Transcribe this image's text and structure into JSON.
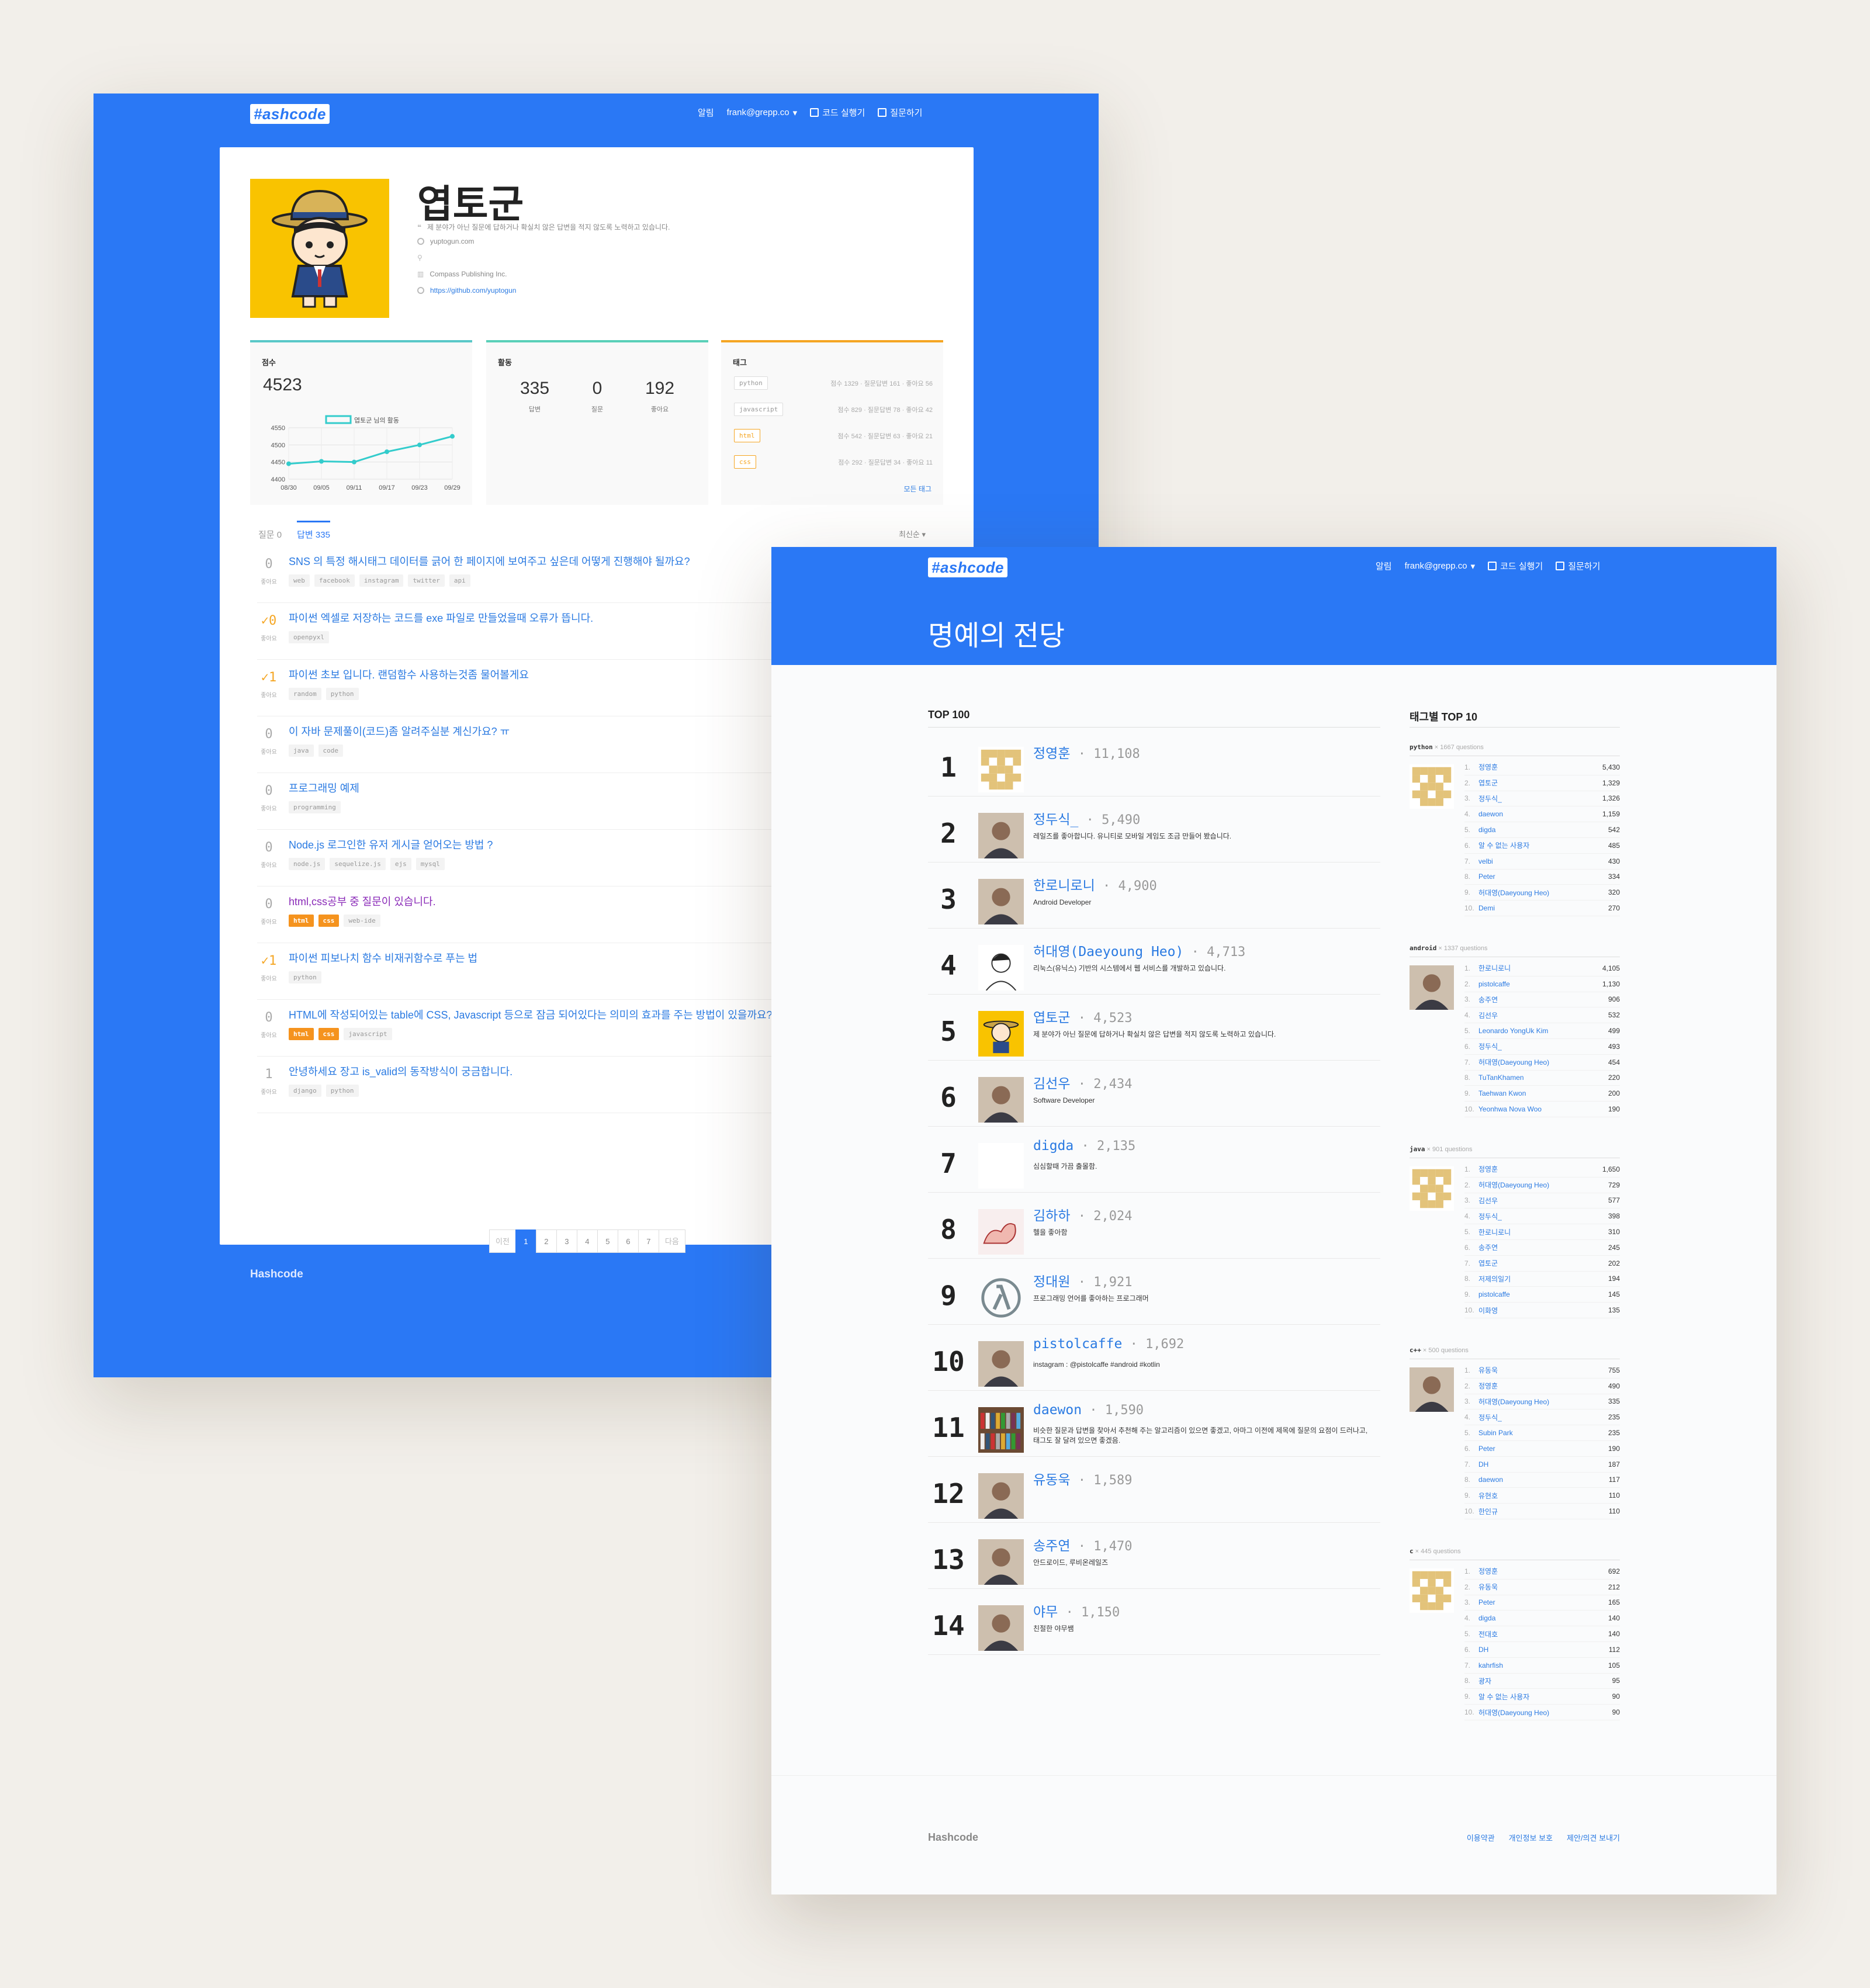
{
  "profile_page": {
    "nav": {
      "logo": "#ashcode",
      "alerts": "알림",
      "user": "frank@grepp.co",
      "run_code": "코드 실행기",
      "ask": "질문하기"
    },
    "user": {
      "name": "엽토군",
      "bio": "제 분야가 아닌 질문에 답하거나 확실치 않은 답변을 적지 않도록 노력하고 있습니다.",
      "website": "yuptogun.com",
      "location": "",
      "company": "Compass Publishing Inc.",
      "github": "https://github.com/yuptogun"
    },
    "score_box": {
      "title": "점수",
      "score": "4523",
      "legend": "엽토군 님의 활동",
      "chart_data": {
        "type": "line",
        "x": [
          "08/30",
          "09/05",
          "09/11",
          "09/17",
          "09/23",
          "09/29"
        ],
        "y_ticks": [
          "4550",
          "4500",
          "4450",
          "4400"
        ],
        "ylim": [
          4400,
          4550
        ],
        "series": [
          {
            "values": [
              4445,
              4452,
              4450,
              4480,
              4500,
              4525
            ]
          }
        ]
      }
    },
    "activity_box": {
      "title": "활동",
      "answers": "335",
      "answers_label": "답변",
      "questions": "0",
      "questions_label": "질문",
      "likes": "192",
      "likes_label": "좋아요"
    },
    "tags_box": {
      "title": "태그",
      "more": "모든 태그",
      "items": [
        {
          "tag": "python",
          "stats": "점수 1329 · 질문답변 161 · 좋아요 56",
          "color": "gray"
        },
        {
          "tag": "javascript",
          "stats": "점수 829 · 질문답변 78 · 좋아요 42",
          "color": "gray"
        },
        {
          "tag": "html",
          "stats": "점수 542 · 질문답변 63 · 좋아요 21",
          "color": "orange"
        },
        {
          "tag": "css",
          "stats": "점수 292 · 질문답변 34 · 좋아요 11",
          "color": "orange"
        }
      ]
    },
    "tabs": {
      "questions": "질문 0",
      "answers": "답변 335",
      "sort": "최신순"
    },
    "questions": [
      {
        "count": "0",
        "label": "좋아요",
        "title": "SNS 의 특정 해시태그 데이터를 긁어 한 페이지에 보여주고 싶은데 어떻게 진행해야 될까요?",
        "accepted": false,
        "visited": false,
        "tags": [
          {
            "t": "web"
          },
          {
            "t": "facebook"
          },
          {
            "t": "instagram"
          },
          {
            "t": "twitter"
          },
          {
            "t": "api"
          }
        ]
      },
      {
        "count": "✓0",
        "label": "좋아요",
        "title": "파이썬 엑셀로 저장하는 코드를 exe 파일로 만들었을때 오류가 뜹니다.",
        "accepted": true,
        "visited": false,
        "tags": [
          {
            "t": "openpyxl"
          }
        ]
      },
      {
        "count": "✓1",
        "label": "좋아요",
        "title": "파이썬 초보 입니다. 랜덤함수 사용하는것좀 물어볼게요",
        "accepted": true,
        "visited": false,
        "tags": [
          {
            "t": "random"
          },
          {
            "t": "python"
          }
        ]
      },
      {
        "count": "0",
        "label": "좋아요",
        "title": "이 자바 문제풀이(코드)좀 알려주실분 계신가요? ㅠ",
        "accepted": false,
        "visited": false,
        "tags": [
          {
            "t": "java"
          },
          {
            "t": "code"
          }
        ]
      },
      {
        "count": "0",
        "label": "좋아요",
        "title": "프로그래밍 예제",
        "accepted": false,
        "visited": false,
        "tags": [
          {
            "t": "programming"
          }
        ]
      },
      {
        "count": "0",
        "label": "좋아요",
        "title": "Node.js 로그인한 유저 게시글 얻어오는 방법 ?",
        "accepted": false,
        "visited": false,
        "tags": [
          {
            "t": "node.js"
          },
          {
            "t": "sequelize.js"
          },
          {
            "t": "ejs"
          },
          {
            "t": "mysql"
          }
        ]
      },
      {
        "count": "0",
        "label": "좋아요",
        "title": "html,css공부 중 질문이 있습니다.",
        "accepted": false,
        "visited": true,
        "tags": [
          {
            "t": "html",
            "o": true
          },
          {
            "t": "css",
            "o": true
          },
          {
            "t": "web-ide"
          }
        ]
      },
      {
        "count": "✓1",
        "label": "좋아요",
        "title": "파이썬 피보나치 함수 비재귀함수로 푸는 법",
        "accepted": true,
        "visited": false,
        "tags": [
          {
            "t": "python"
          }
        ]
      },
      {
        "count": "0",
        "label": "좋아요",
        "title": "HTML에 작성되어있는 table에 CSS, Javascript 등으로 잠금 되어있다는 의미의 효과를 주는 방법이 있을까요?",
        "accepted": false,
        "visited": false,
        "tags": [
          {
            "t": "html",
            "o": true
          },
          {
            "t": "css",
            "o": true
          },
          {
            "t": "javascript"
          }
        ]
      },
      {
        "count": "1",
        "label": "좋아요",
        "title": "안녕하세요 장고 is_valid의 동작방식이 궁금합니다.",
        "accepted": false,
        "visited": false,
        "tags": [
          {
            "t": "django"
          },
          {
            "t": "python"
          }
        ]
      }
    ],
    "pager": [
      "이전",
      "1",
      "2",
      "3",
      "4",
      "5",
      "6",
      "7",
      "다음"
    ],
    "footer": "Hashcode"
  },
  "hall_page": {
    "nav": {
      "logo": "#ashcode",
      "alerts": "알림",
      "user": "frank@grepp.co",
      "run_code": "코드 실행기",
      "ask": "질문하기"
    },
    "title": "명예의 전당",
    "top_title": "TOP 100",
    "tag_title": "태그별 TOP 10",
    "ranking": [
      {
        "rank": "1",
        "name": "정영훈",
        "score": "· 11,108",
        "desc": "",
        "avatar": "pixel"
      },
      {
        "rank": "2",
        "name": "정두식_",
        "score": "· 5,490",
        "desc": "레일즈를 좋아합니다. 유니티로 모바일 게임도 조금 만들어 봤습니다.",
        "avatar": "photo"
      },
      {
        "rank": "3",
        "name": "한로니로니",
        "score": "· 4,900",
        "desc": "Android Developer",
        "avatar": "photo"
      },
      {
        "rank": "4",
        "name": "허대영(Daeyoung Heo)",
        "score": "· 4,713",
        "desc": "리눅스(유닉스) 기반의 시스템에서 웹 서비스를 개발하고 있습니다.",
        "avatar": "sketch"
      },
      {
        "rank": "5",
        "name": "엽토군",
        "score": "· 4,523",
        "desc": "제 분야가 아닌 질문에 답하거나 확실치 않은 답변을 적지 않도록 노력하고 있습니다.",
        "avatar": "char"
      },
      {
        "rank": "6",
        "name": "김선우",
        "score": "· 2,434",
        "desc": "Software Developer",
        "avatar": "photo"
      },
      {
        "rank": "7",
        "name": "digda",
        "score": "· 2,135",
        "desc": "심심할때 가끔 출몰함.",
        "avatar": "blank"
      },
      {
        "rank": "8",
        "name": "김하하",
        "score": "· 2,024",
        "desc": "헬을 좋아함",
        "avatar": "arm"
      },
      {
        "rank": "9",
        "name": "정대원",
        "score": "· 1,921",
        "desc": "프로그래밍 언어를 좋아하는 프로그래머",
        "avatar": "lambda"
      },
      {
        "rank": "10",
        "name": "pistolcaffe",
        "score": "· 1,692",
        "desc": "instagram : @pistolcaffe #android #kotlin",
        "avatar": "photo"
      },
      {
        "rank": "11",
        "name": "daewon",
        "score": "· 1,590",
        "desc": "비슷한 질문과 답변을 찾아서 추천해 주는 알고리즘이 있으면 좋겠고, 아마그 이전에 제목에 질문의 요점이 드러나고, 태그도 잘 달려 있으면 좋겠음.",
        "avatar": "books"
      },
      {
        "rank": "12",
        "name": "유동욱",
        "score": "· 1,589",
        "desc": "",
        "avatar": "photo"
      },
      {
        "rank": "13",
        "name": "송주연",
        "score": "· 1,470",
        "desc": "안드로이드, 루비온레일즈",
        "avatar": "photo"
      },
      {
        "rank": "14",
        "name": "야무",
        "score": "· 1,150",
        "desc": "친절한 야무쌤",
        "avatar": "photo"
      }
    ],
    "tag_groups": [
      {
        "tag": "python",
        "count": "× 1667 questions",
        "avatar": "pixel",
        "items": [
          [
            "1.",
            "정영훈",
            "5,430"
          ],
          [
            "2.",
            "엽토군",
            "1,329"
          ],
          [
            "3.",
            "정두식_",
            "1,326"
          ],
          [
            "4.",
            "daewon",
            "1,159"
          ],
          [
            "5.",
            "digda",
            "542"
          ],
          [
            "6.",
            "알 수 없는 사용자",
            "485"
          ],
          [
            "7.",
            "velbi",
            "430"
          ],
          [
            "8.",
            "Peter",
            "334"
          ],
          [
            "9.",
            "허대영(Daeyoung Heo)",
            "320"
          ],
          [
            "10.",
            "Demi",
            "270"
          ]
        ]
      },
      {
        "tag": "android",
        "count": "× 1337 questions",
        "avatar": "photo",
        "items": [
          [
            "1.",
            "한로니로니",
            "4,105"
          ],
          [
            "2.",
            "pistolcaffe",
            "1,130"
          ],
          [
            "3.",
            "송주연",
            "906"
          ],
          [
            "4.",
            "김선우",
            "532"
          ],
          [
            "5.",
            "Leonardo YongUk Kim",
            "499"
          ],
          [
            "6.",
            "정두식_",
            "493"
          ],
          [
            "7.",
            "허대영(Daeyoung Heo)",
            "454"
          ],
          [
            "8.",
            "TuTanKhamen",
            "220"
          ],
          [
            "9.",
            "Taehwan Kwon",
            "200"
          ],
          [
            "10.",
            "Yeonhwa Nova Woo",
            "190"
          ]
        ]
      },
      {
        "tag": "java",
        "count": "× 901 questions",
        "avatar": "pixel",
        "items": [
          [
            "1.",
            "정영훈",
            "1,650"
          ],
          [
            "2.",
            "허대영(Daeyoung Heo)",
            "729"
          ],
          [
            "3.",
            "김선우",
            "577"
          ],
          [
            "4.",
            "정두식_",
            "398"
          ],
          [
            "5.",
            "한로니로니",
            "310"
          ],
          [
            "6.",
            "송주연",
            "245"
          ],
          [
            "7.",
            "엽토군",
            "202"
          ],
          [
            "8.",
            "저제의일기",
            "194"
          ],
          [
            "9.",
            "pistolcaffe",
            "145"
          ],
          [
            "10.",
            "이화영",
            "135"
          ]
        ]
      },
      {
        "tag": "c++",
        "count": "× 500 questions",
        "avatar": "photo",
        "items": [
          [
            "1.",
            "유동욱",
            "755"
          ],
          [
            "2.",
            "정영훈",
            "490"
          ],
          [
            "3.",
            "허대영(Daeyoung Heo)",
            "335"
          ],
          [
            "4.",
            "정두식_",
            "235"
          ],
          [
            "5.",
            "Subin Park",
            "235"
          ],
          [
            "6.",
            "Peter",
            "190"
          ],
          [
            "7.",
            "DH",
            "187"
          ],
          [
            "8.",
            "daewon",
            "117"
          ],
          [
            "9.",
            "유현호",
            "110"
          ],
          [
            "10.",
            "한인규",
            "110"
          ]
        ]
      },
      {
        "tag": "c",
        "count": "× 445 questions",
        "avatar": "pixel",
        "items": [
          [
            "1.",
            "정영훈",
            "692"
          ],
          [
            "2.",
            "유동욱",
            "212"
          ],
          [
            "3.",
            "Peter",
            "165"
          ],
          [
            "4.",
            "digda",
            "140"
          ],
          [
            "5.",
            "전대호",
            "140"
          ],
          [
            "6.",
            "DH",
            "112"
          ],
          [
            "7.",
            "kahrfish",
            "105"
          ],
          [
            "8.",
            "광자",
            "95"
          ],
          [
            "9.",
            "알 수 없는 사용자",
            "90"
          ],
          [
            "10.",
            "허대영(Daeyoung Heo)",
            "90"
          ]
        ]
      }
    ],
    "footer": {
      "brand": "Hashcode",
      "links": [
        "이용약관",
        "개인정보 보호",
        "제안/의견 보내기"
      ]
    }
  }
}
